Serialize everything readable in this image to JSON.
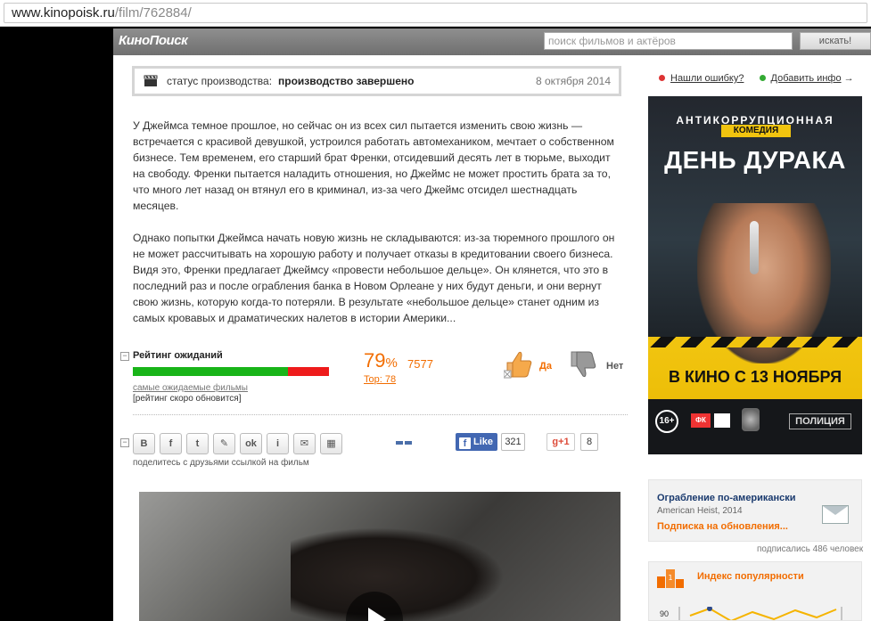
{
  "browser": {
    "url_host": "www.kinopoisk.ru",
    "url_path": "/film/762884/"
  },
  "header": {
    "logo": "КиноПоиск",
    "search_placeholder": "поиск фильмов и актёров",
    "search_button": "искать!"
  },
  "status": {
    "label": "статус производства:",
    "value": "производство завершено",
    "date": "8 октября 2014"
  },
  "description": {
    "p1": "У Джеймса темное прошлое, но сейчас он из всех сил пытается изменить свою жизнь — встречается с красивой девушкой, устроился работать автомехаником, мечтает о собственном бизнесе. Тем временем, его старший брат Френки, отсидевший десять лет в тюрьме, выходит на свободу. Френки пытается наладить отношения, но Джеймс не может простить брата за то, что много лет назад он втянул его в криминал, из-за чего Джеймс отсидел шестнадцать месяцев.",
    "p2": "Однако попытки Джеймса начать новую жизнь не складываются: из-за тюремного прошлого он не может рассчитывать на хорошую работу и получает отказы в кредитовании своего бизнеса. Видя это, Френки предлагает Джеймсу «провести небольшое дельце». Он клянется, что это в последний раз и после ограбления банка в Новом Орлеане у них будут деньги, и они вернут свою жизнь, которую когда-то потеряли. В результате «небольшое дельце» станет одним из самых кровавых и драматических налетов в истории Америки..."
  },
  "rating": {
    "title": "Рейтинг ожиданий",
    "percent": "79",
    "percent_sign": "%",
    "percent_value": 79,
    "votes": "7577",
    "top": "Top: 78",
    "link": "самые ожидаемые фильмы",
    "note": "[рейтинг скоро обновится]",
    "yes": "Да",
    "no": "Нет"
  },
  "share": {
    "buttons": [
      {
        "glyph": "B",
        "icon": "vkontakte-icon"
      },
      {
        "glyph": "f",
        "icon": "facebook-icon"
      },
      {
        "glyph": "t",
        "icon": "twitter-icon"
      },
      {
        "glyph": "✎",
        "icon": "livejournal-icon"
      },
      {
        "glyph": "ok",
        "icon": "odnoklassniki-icon"
      },
      {
        "glyph": "i",
        "icon": "liveinternet-icon"
      },
      {
        "glyph": "✉",
        "icon": "email-icon"
      },
      {
        "glyph": "▦",
        "icon": "qr-code-icon"
      }
    ],
    "caption": "поделитесь с друзьями ссылкой на фильм",
    "fb_like": "Like",
    "fb_count": "321",
    "gplus": "g+1",
    "gplus_count": "8"
  },
  "right": {
    "report_error": "Нашли ошибку?",
    "add_info": "Добавить инфо",
    "add_info_arrow": "→",
    "poster": {
      "subtitle": "АНТИКОРРУПЦИОННАЯ",
      "genre": "КОМЕДИЯ",
      "title": "ДЕНЬ ДУРАКА",
      "release": "В КИНО С 13 НОЯБРЯ",
      "age": "16+",
      "badge": "ПОЛИЦИЯ",
      "logo_fk": "ФК"
    },
    "subscription": {
      "title": "Ограбление по-американски",
      "original": "American Heist, 2014",
      "link": "Подписка на обновления...",
      "count": "подписались 486 человек"
    },
    "popularity": {
      "title": "Индекс популярности",
      "axis": "90"
    }
  },
  "colors": {
    "accent": "#f26d00",
    "positive": "#19b419",
    "negative": "#ee1b1b",
    "link": "#1a3a6e"
  }
}
